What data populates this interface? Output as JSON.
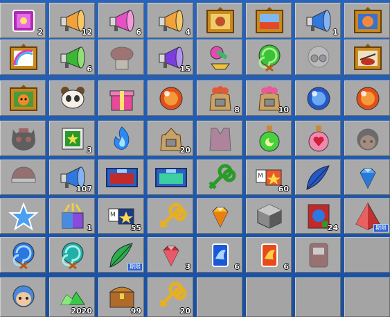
{
  "inventory": {
    "slots": [
      {
        "icon": "purple-gem-box-icon",
        "qty": "2"
      },
      {
        "icon": "orange-megaphone-icon",
        "qty": "12"
      },
      {
        "icon": "pink-megaphone-icon",
        "qty": "6"
      },
      {
        "icon": "orange-megaphone-icon",
        "qty": "4"
      },
      {
        "icon": "framed-bear-picture-icon",
        "qty": ""
      },
      {
        "icon": "framed-landscape-picture-icon",
        "qty": ""
      },
      {
        "icon": "blue-megaphone-icon",
        "qty": "1"
      },
      {
        "icon": "framed-horse-picture-icon",
        "qty": ""
      },
      {
        "icon": "framed-rainbow-picture-icon",
        "qty": ""
      },
      {
        "icon": "green-megaphone-icon",
        "qty": "6"
      },
      {
        "icon": "red-crab-gift-icon",
        "qty": ""
      },
      {
        "icon": "purple-megaphone-icon",
        "qty": "15"
      },
      {
        "icon": "sweets-bundle-icon",
        "qty": ""
      },
      {
        "icon": "green-lollipop-icon",
        "qty": ""
      },
      {
        "icon": "grey-hair-glasses-icon",
        "qty": ""
      },
      {
        "icon": "framed-ramen-picture-icon",
        "qty": ""
      },
      {
        "icon": "framed-tiger-picture-icon",
        "qty": ""
      },
      {
        "icon": "panda-head-icon",
        "qty": ""
      },
      {
        "icon": "pink-gift-box-icon",
        "qty": ""
      },
      {
        "icon": "orange-orb-icon",
        "qty": ""
      },
      {
        "icon": "crab-sack-icon",
        "qty": "8"
      },
      {
        "icon": "pink-sack-icon",
        "qty": "10"
      },
      {
        "icon": "blue-orb-icon",
        "qty": ""
      },
      {
        "icon": "orange-orb-icon",
        "qty": ""
      },
      {
        "icon": "black-cat-hat-icon",
        "qty": ""
      },
      {
        "icon": "green-star-card-icon",
        "qty": "3"
      },
      {
        "icon": "blue-flame-icon",
        "qty": ""
      },
      {
        "icon": "money-sack-icon",
        "qty": "20"
      },
      {
        "icon": "pink-vest-icon",
        "qty": ""
      },
      {
        "icon": "green-potion-icon",
        "qty": ""
      },
      {
        "icon": "pink-heart-potion-icon",
        "qty": ""
      },
      {
        "icon": "black-hair-head-icon",
        "qty": ""
      },
      {
        "icon": "red-cap-icon",
        "qty": ""
      },
      {
        "icon": "blue-megaphone-icon",
        "qty": "107"
      },
      {
        "icon": "red-ticket-card-icon",
        "qty": ""
      },
      {
        "icon": "blue-ticket-card-icon",
        "qty": ""
      },
      {
        "icon": "green-clover-key-icon",
        "qty": ""
      },
      {
        "icon": "star-letter-icon",
        "qty": "60"
      },
      {
        "icon": "blue-feather-icon",
        "qty": ""
      },
      {
        "icon": "blue-diamond-icon",
        "qty": ""
      },
      {
        "icon": "blue-star-icon",
        "qty": ""
      },
      {
        "icon": "rainbow-gift-box-icon",
        "qty": "1"
      },
      {
        "icon": "blue-star-letter-icon",
        "qty": "55"
      },
      {
        "icon": "gold-key-icon",
        "qty": ""
      },
      {
        "icon": "orange-gem-icon",
        "qty": ""
      },
      {
        "icon": "silver-cube-icon",
        "qty": ""
      },
      {
        "icon": "blue-orb-card-icon",
        "qty": "24"
      },
      {
        "icon": "red-pyramid-icon",
        "qty": "",
        "badge": "期限"
      },
      {
        "icon": "blue-swirl-lollipop-icon",
        "qty": ""
      },
      {
        "icon": "teal-swirl-lollipop-icon",
        "qty": ""
      },
      {
        "icon": "green-feather-icon",
        "qty": "",
        "badge": "期限"
      },
      {
        "icon": "red-gem-bag-icon",
        "qty": "3"
      },
      {
        "icon": "blue-wing-card-icon",
        "qty": "6"
      },
      {
        "icon": "orange-wing-card-icon",
        "qty": "6"
      },
      {
        "icon": "red-furniture-icon",
        "qty": ""
      },
      {
        "icon": "empty",
        "qty": ""
      },
      {
        "icon": "blue-bear-head-icon",
        "qty": ""
      },
      {
        "icon": "green-gem-pile-icon",
        "qty": "2020"
      },
      {
        "icon": "treasure-chest-icon",
        "qty": "99"
      },
      {
        "icon": "gold-key-icon",
        "qty": "20"
      },
      {
        "icon": "empty",
        "qty": ""
      },
      {
        "icon": "empty",
        "qty": ""
      },
      {
        "icon": "empty",
        "qty": ""
      },
      {
        "icon": "empty",
        "qty": ""
      }
    ]
  }
}
